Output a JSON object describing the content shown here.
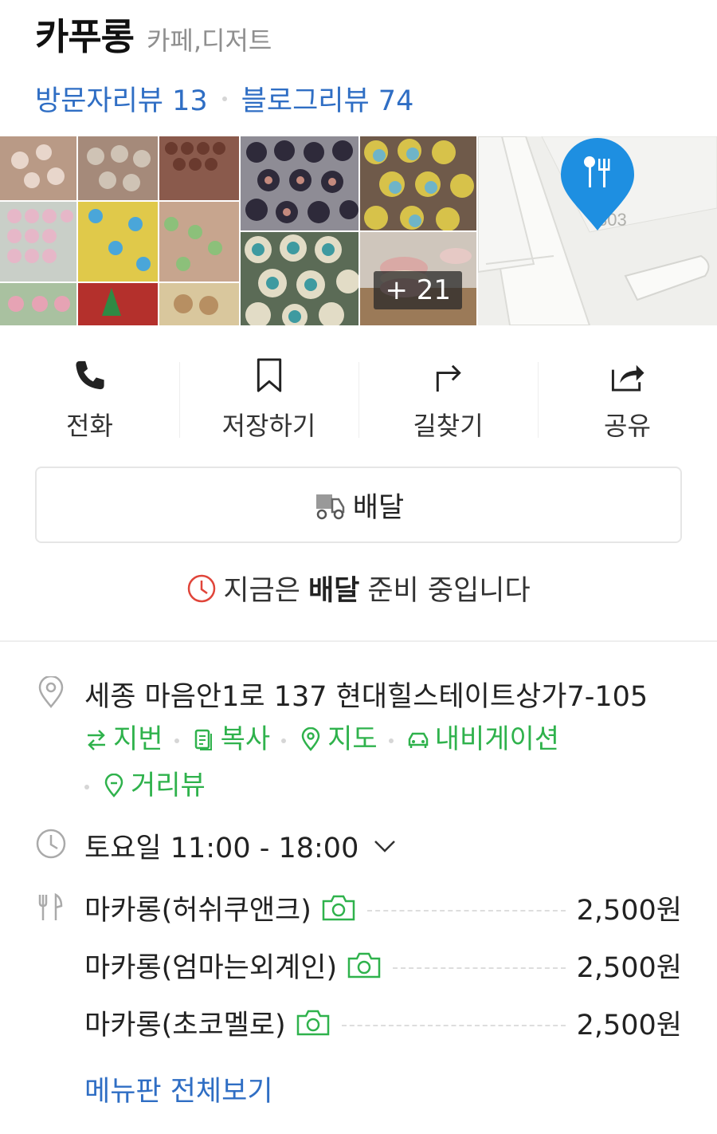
{
  "place": {
    "name": "카푸롱",
    "category": "카페,디저트",
    "visit_reviews": "방문자리뷰 13",
    "blog_reviews": "블로그리뷰 74"
  },
  "photos": {
    "more_count": "+ 21",
    "map_label": "803"
  },
  "actions": [
    {
      "label": "전화",
      "icon": "phone-icon"
    },
    {
      "label": "저장하기",
      "icon": "bookmark-icon"
    },
    {
      "label": "길찾기",
      "icon": "directions-icon"
    },
    {
      "label": "공유",
      "icon": "share-icon"
    }
  ],
  "delivery": {
    "button_label": "배달",
    "status_prefix": "지금은",
    "status_bold": "배달",
    "status_suffix": "준비 중입니다"
  },
  "address": {
    "text": "세종 마음안1로 137 현대힐스테이트상가7-105",
    "links": [
      "지번",
      "복사",
      "지도",
      "내비게이션",
      "거리뷰"
    ]
  },
  "hours": {
    "text": "토요일 11:00 - 18:00"
  },
  "menu": {
    "items": [
      {
        "name": "마카롱(허쉬쿠앤크)",
        "price": "2,500원"
      },
      {
        "name": "마카롱(엄마는외계인)",
        "price": "2,500원"
      },
      {
        "name": "마카롱(초코멜로)",
        "price": "2,500원"
      }
    ],
    "view_all": "메뉴판 전체보기"
  },
  "colors": {
    "link_blue": "#2f6ec4",
    "link_green": "#2fb24c",
    "map_pin": "#1e8fe1",
    "alert_red": "#e0453a"
  }
}
